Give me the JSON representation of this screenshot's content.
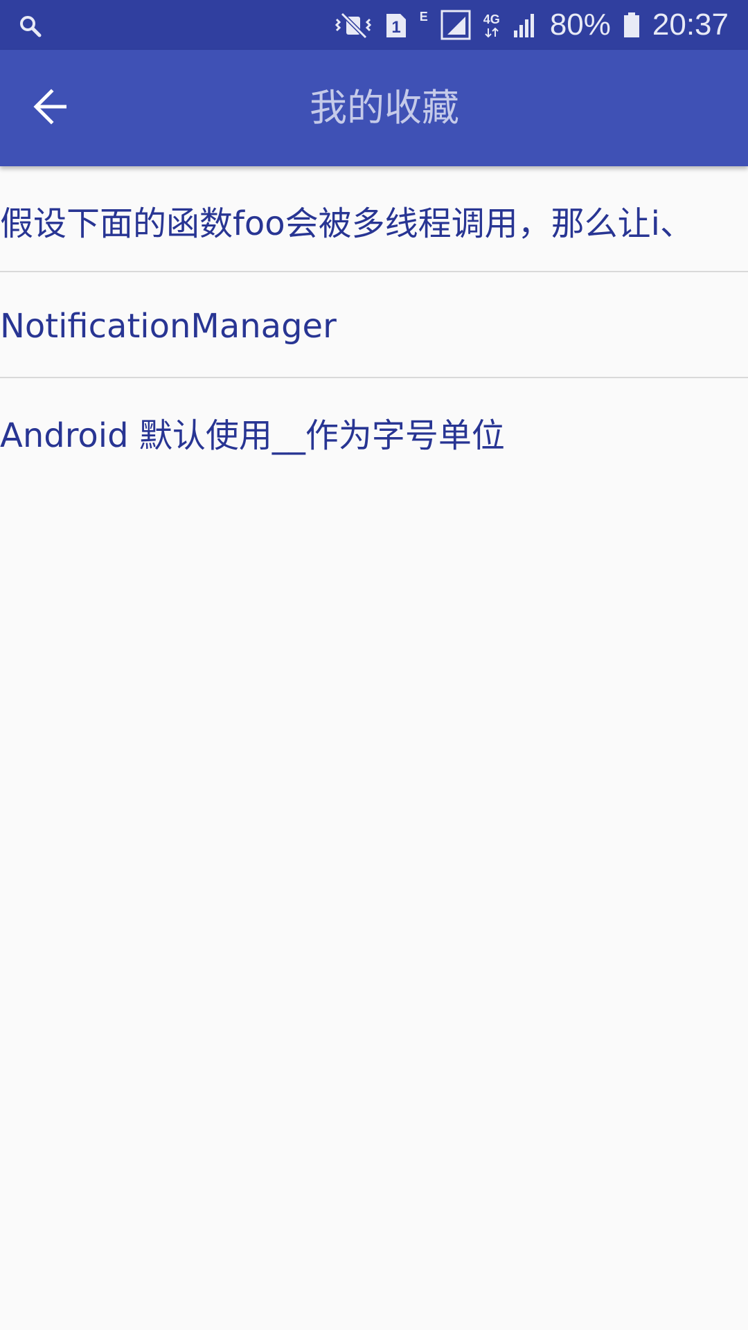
{
  "status_bar": {
    "left_icon": "search-icon",
    "icons": [
      "vibrate-mute-icon",
      "sim1-icon",
      "edge-network-icon",
      "signal-sim1-icon",
      "4g-data-icon",
      "signal-sim2-icon"
    ],
    "sim_label": "1",
    "network_label": "E",
    "data_label": "4G",
    "battery_percent": "80%",
    "battery_icon": "battery-icon",
    "time": "20:37"
  },
  "app_bar": {
    "back_icon": "arrow-left-icon",
    "title": "我的收藏"
  },
  "favorites": {
    "items": [
      {
        "label": "假设下面的函数foo会被多线程调用，那么让i、"
      },
      {
        "label": "NotificationManager"
      },
      {
        "label": "Android 默认使用__作为字号单位"
      }
    ]
  },
  "colors": {
    "status_bar_bg": "#303f9f",
    "app_bar_bg": "#3f51b5",
    "title_text": "#c5cae9",
    "item_text": "#283593",
    "background": "#fafafa",
    "divider": "#d9d9d9"
  }
}
